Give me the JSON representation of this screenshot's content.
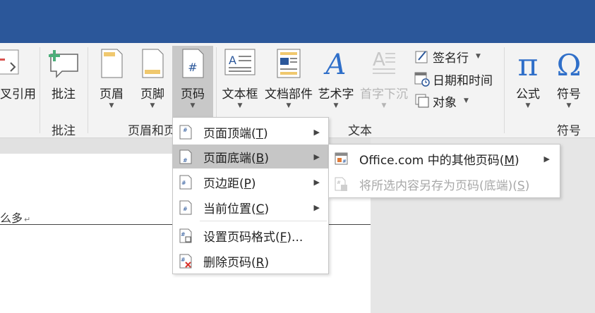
{
  "ribbon": {
    "cross_ref_label": "叉引用",
    "comment_label": "批注",
    "header_label": "页眉",
    "footer_label": "页脚",
    "page_number_label": "页码",
    "textbox_label": "文本框",
    "quick_parts_label": "文档部件",
    "wordart_label": "艺术字",
    "dropcap_label": "首字下沉",
    "signature_label": "签名行",
    "datetime_label": "日期和时间",
    "object_label": "对象",
    "equation_label": "公式",
    "symbol_label": "符号",
    "groups": {
      "comments": "批注",
      "header_footer": "页眉和页",
      "text": "文本",
      "symbols": "符号"
    }
  },
  "document": {
    "visible_text": "么多",
    "paragraph_mark": "↵"
  },
  "page_number_menu": {
    "items": [
      {
        "text": "页面顶端(",
        "key": "T",
        "end": ")"
      },
      {
        "text": "页面底端(",
        "key": "B",
        "end": ")"
      },
      {
        "text": "页边距(",
        "key": "P",
        "end": ")"
      },
      {
        "text": "当前位置(",
        "key": "C",
        "end": ")"
      },
      {
        "text": "设置页码格式(",
        "key": "F",
        "end": ")..."
      },
      {
        "text": "删除页码(",
        "key": "R",
        "end": ")"
      }
    ]
  },
  "bottom_submenu": {
    "items": [
      {
        "text": "Office.com 中的其他页码(",
        "key": "M",
        "end": ")"
      },
      {
        "text": "将所选内容另存为页码(底端)(",
        "key": "S",
        "end": ")"
      }
    ]
  },
  "colors": {
    "title_bar": "#2b579a",
    "ribbon_bg": "#f3f3f3",
    "accent_blue": "#2b579a",
    "highlight": "#c6c6c6"
  }
}
